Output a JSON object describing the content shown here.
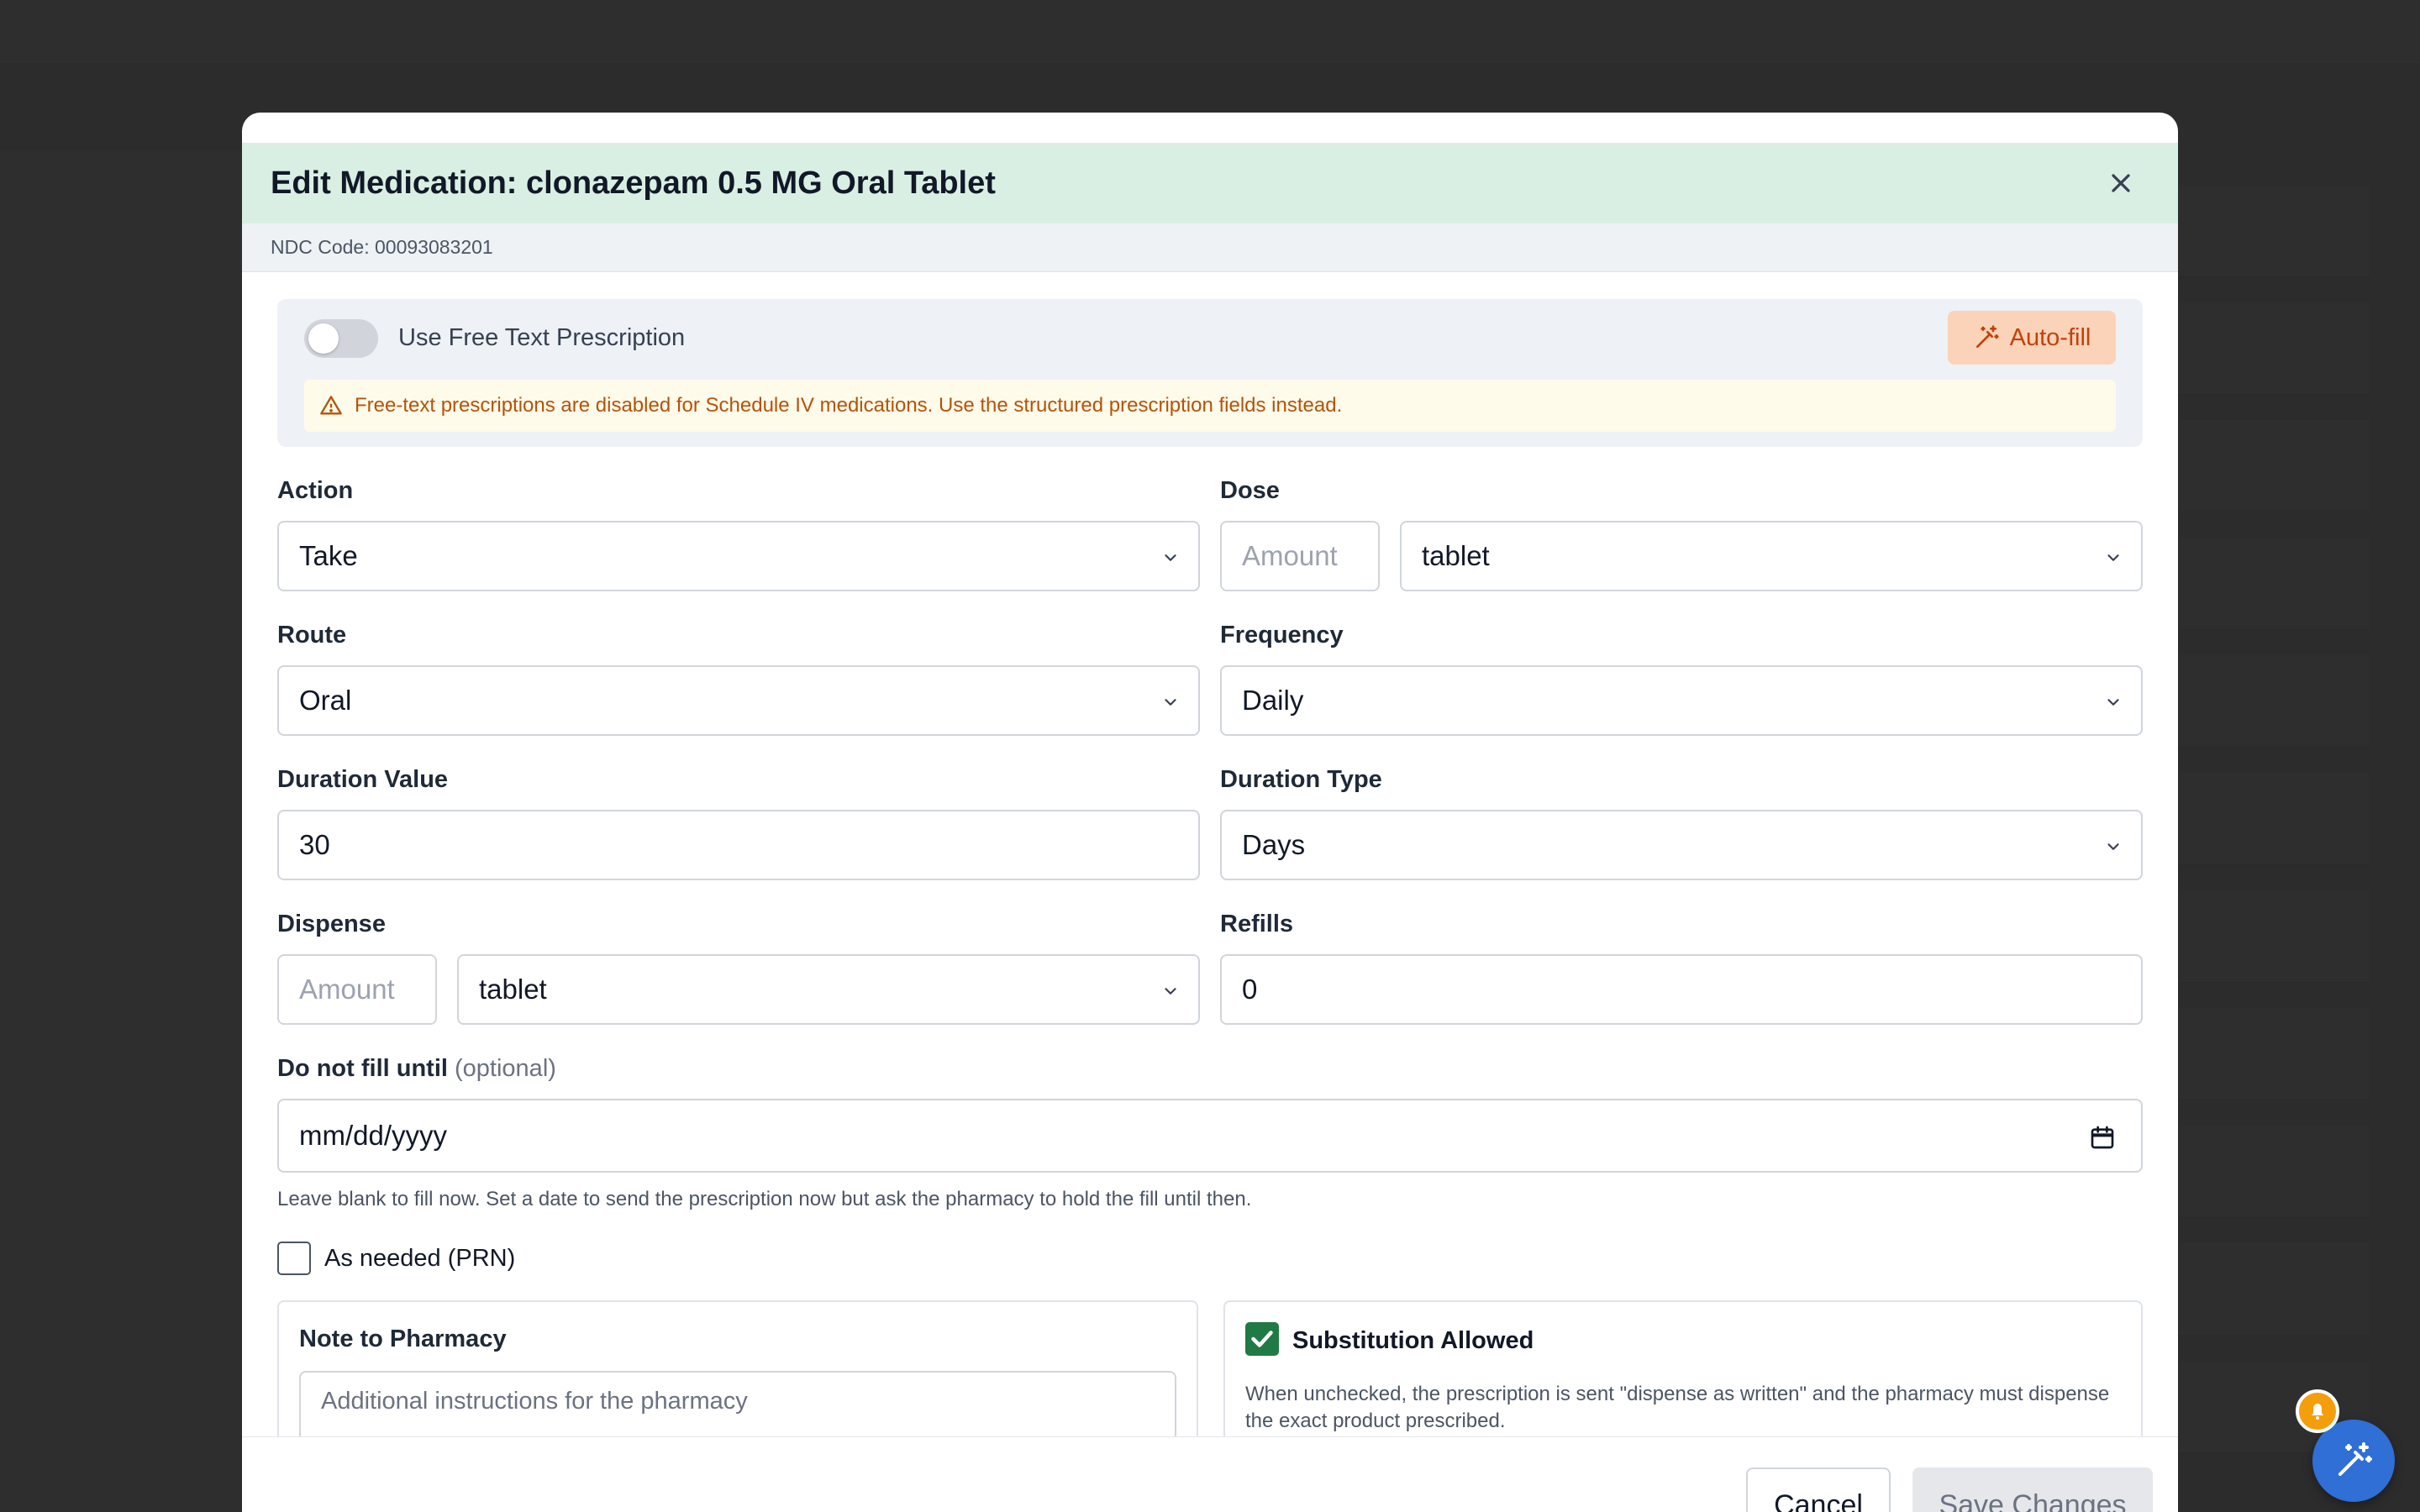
{
  "modal": {
    "title": "Edit Medication: clonazepam 0.5 MG Oral Tablet",
    "ndc": "NDC Code: 00093083201",
    "free_text": {
      "toggle_label": "Use Free Text Prescription",
      "toggle_on": false,
      "autofill_label": "Auto-fill",
      "warning": "Free-text prescriptions are disabled for Schedule IV medications. Use the structured prescription fields instead."
    },
    "action": {
      "label": "Action",
      "value": "Take"
    },
    "dose": {
      "label": "Dose",
      "amount_placeholder": "Amount",
      "unit": "tablet"
    },
    "route": {
      "label": "Route",
      "value": "Oral"
    },
    "frequency": {
      "label": "Frequency",
      "value": "Daily"
    },
    "duration_value": {
      "label": "Duration Value",
      "value": "30"
    },
    "duration_type": {
      "label": "Duration Type",
      "value": "Days"
    },
    "dispense": {
      "label": "Dispense",
      "amount_placeholder": "Amount",
      "unit": "tablet"
    },
    "refills": {
      "label": "Refills",
      "value": "0"
    },
    "do_not_fill": {
      "label": "Do not fill until",
      "optional": "(optional)",
      "placeholder": "mm/dd/yyyy",
      "help": "Leave blank to fill now. Set a date to send the prescription now but ask the pharmacy to hold the fill until then."
    },
    "prn": {
      "label": "As needed (PRN)",
      "checked": false
    },
    "note": {
      "label": "Note to Pharmacy",
      "placeholder": "Additional instructions for the pharmacy"
    },
    "substitution": {
      "label": "Substitution Allowed",
      "checked": true,
      "help": "When unchecked, the prescription is sent \"dispense as written\" and the pharmacy must dispense the exact product prescribed."
    },
    "footer": {
      "cancel": "Cancel",
      "save": "Save Changes"
    }
  },
  "colors": {
    "header_bg": "#daefe3",
    "warning_text": "#b45309",
    "autofill_bg": "#fbd3b8",
    "checkbox_green": "#1f7a45",
    "fab_blue": "#2f6fd6",
    "badge_orange": "#f59e0b"
  },
  "icons": {
    "close": "close-icon",
    "autofill": "magic-wand-icon",
    "warning": "warning-triangle-icon",
    "chevron": "chevron-down-icon",
    "calendar": "calendar-icon",
    "fab": "magic-wand-icon",
    "badge": "bell-icon"
  }
}
